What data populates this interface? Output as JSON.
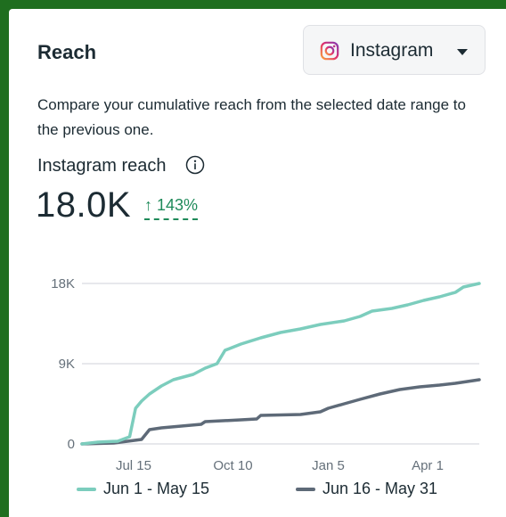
{
  "card": {
    "title": "Reach",
    "description": "Compare your cumulative reach from the selected date range to the previous one.",
    "platform_dropdown": {
      "selected": "Instagram",
      "icon": "instagram-icon"
    },
    "metric": {
      "label": "Instagram reach",
      "value": "18.0K",
      "change": "↑ 143%"
    }
  },
  "colors": {
    "current": "#7ccdbd",
    "previous": "#5e6a78",
    "positive": "#1f8a5a"
  },
  "chart_data": {
    "type": "line",
    "ylim": [
      0,
      18000
    ],
    "y_ticks": [
      "18K",
      "9K",
      "0"
    ],
    "x_ticks": [
      "Jul 15",
      "Oct 10",
      "Jan 5",
      "Apr 1"
    ],
    "legend_position": "bottom",
    "grid": true,
    "series": [
      {
        "name": "Jun 1 - May 15",
        "x": [
          0,
          0.04,
          0.09,
          0.12,
          0.135,
          0.15,
          0.17,
          0.2,
          0.23,
          0.28,
          0.31,
          0.34,
          0.36,
          0.4,
          0.45,
          0.5,
          0.55,
          0.6,
          0.66,
          0.7,
          0.73,
          0.78,
          0.82,
          0.86,
          0.9,
          0.94,
          0.96,
          1.0
        ],
        "values": [
          0,
          200,
          300,
          800,
          4000,
          4800,
          5600,
          6500,
          7200,
          7800,
          8500,
          9000,
          10500,
          11200,
          11900,
          12500,
          12900,
          13400,
          13800,
          14300,
          14900,
          15200,
          15600,
          16100,
          16500,
          17000,
          17600,
          18000
        ]
      },
      {
        "name": "Jun 16 - May 31",
        "x": [
          0,
          0.08,
          0.15,
          0.17,
          0.2,
          0.25,
          0.3,
          0.31,
          0.4,
          0.44,
          0.45,
          0.55,
          0.6,
          0.62,
          0.66,
          0.7,
          0.75,
          0.8,
          0.85,
          0.9,
          0.94,
          0.97,
          1.0
        ],
        "values": [
          0,
          100,
          500,
          1600,
          1800,
          2000,
          2200,
          2500,
          2700,
          2800,
          3200,
          3300,
          3600,
          4000,
          4500,
          5000,
          5600,
          6100,
          6400,
          6600,
          6800,
          7000,
          7200
        ]
      }
    ]
  }
}
